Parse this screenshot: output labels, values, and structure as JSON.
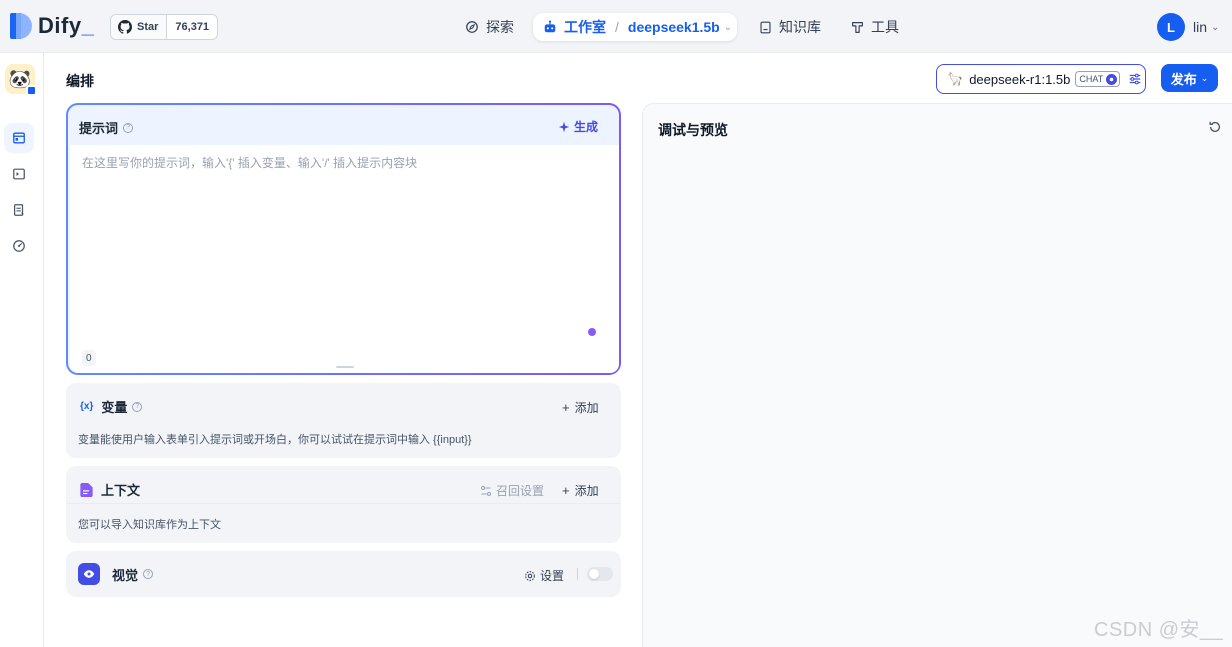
{
  "brand": {
    "name": "Dify",
    "suffix": "_"
  },
  "github": {
    "star_label": "Star",
    "count": "76,371"
  },
  "nav": {
    "explore": "探索",
    "studio": "工作室",
    "app_name": "deepseek1.5b",
    "knowledge": "知识库",
    "tools": "工具"
  },
  "user": {
    "initial": "L",
    "name": "lin"
  },
  "page": {
    "title": "编排"
  },
  "model": {
    "name": "deepseek-r1:1.5b",
    "mode_badge": "CHAT"
  },
  "publish_label": "发布",
  "prompt": {
    "title": "提示词",
    "generate_label": "生成",
    "placeholder": "在这里写你的提示词，输入'{' 插入变量、输入'/' 插入提示内容块",
    "char_count": "0"
  },
  "variables": {
    "title": "变量",
    "icon_text": "{x}",
    "add_label": "添加",
    "description": "变量能使用户输入表单引入提示词或开场白，你可以试试在提示词中输入 {{input}}"
  },
  "context": {
    "title": "上下文",
    "recall_label": "召回设置",
    "add_label": "添加",
    "description": "您可以导入知识库作为上下文"
  },
  "vision": {
    "title": "视觉",
    "settings_label": "设置"
  },
  "preview": {
    "title": "调试与预览"
  },
  "watermark": "CSDN @安__",
  "colors": {
    "primary": "#155eef",
    "accent": "#444ce7",
    "purple": "#875bf7"
  }
}
